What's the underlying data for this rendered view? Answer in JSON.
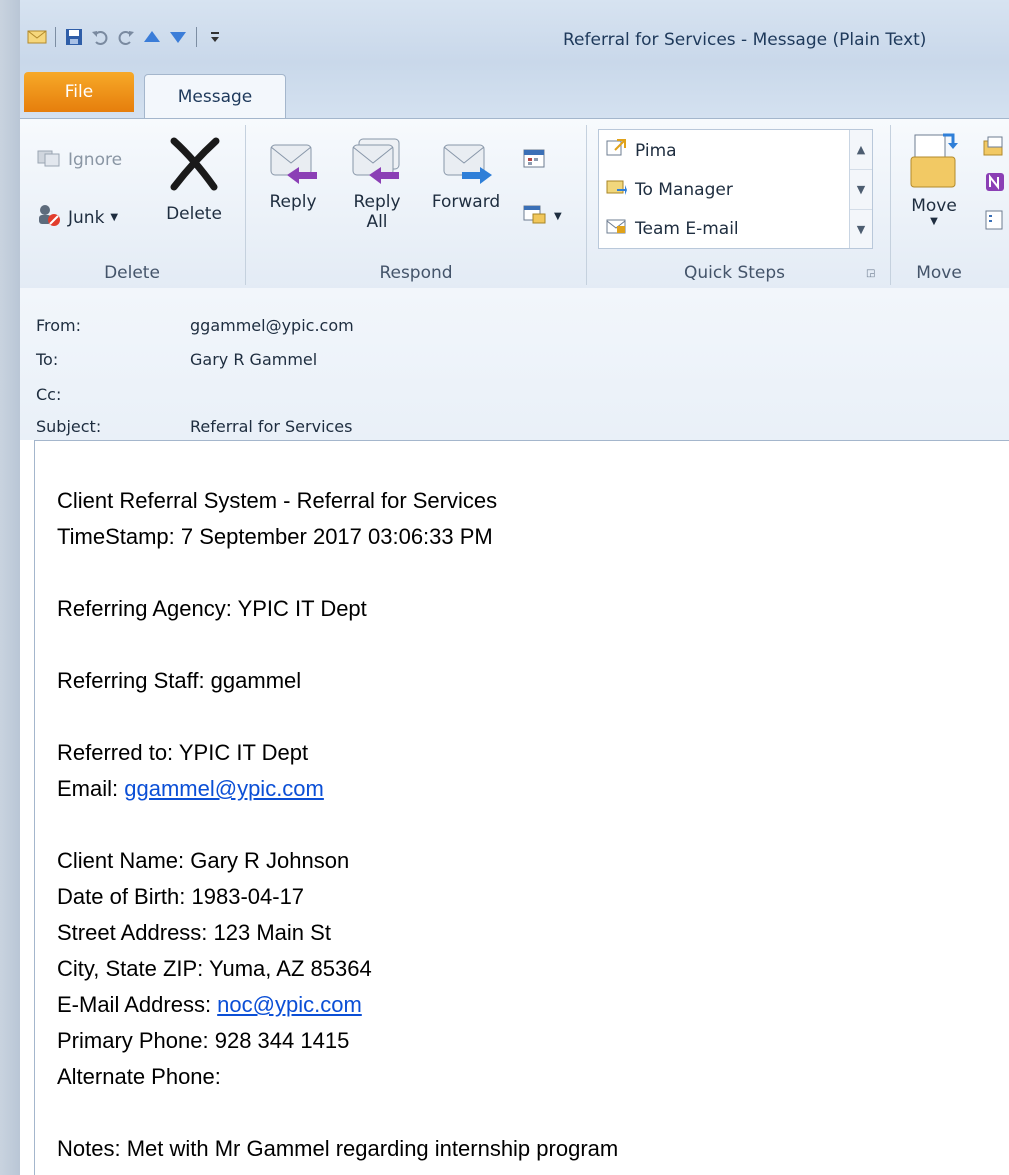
{
  "window": {
    "title": "Referral for Services  -  Message (Plain Text)"
  },
  "quick_access": [
    "mail-icon",
    "save-icon",
    "undo-icon",
    "redo-icon",
    "up-arrow-icon",
    "down-arrow-icon",
    "customize-icon"
  ],
  "tabs": {
    "file": "File",
    "message": "Message"
  },
  "ribbon": {
    "delete_group": {
      "ignore": "Ignore",
      "junk": "Junk",
      "delete": "Delete",
      "label": "Delete"
    },
    "respond_group": {
      "reply": "Reply",
      "reply_all_1": "Reply",
      "reply_all_2": "All",
      "forward": "Forward",
      "label": "Respond"
    },
    "quick_steps": {
      "items": [
        "Pima",
        "To Manager",
        "Team E-mail"
      ],
      "label": "Quick Steps"
    },
    "move_group": {
      "move": "Move",
      "label": "Move"
    }
  },
  "header": {
    "from_label": "From:",
    "from_value": "ggammel@ypic.com",
    "to_label": "To:",
    "to_value": "Gary R Gammel",
    "cc_label": "Cc:",
    "cc_value": "",
    "subject_label": "Subject:",
    "subject_value": "Referral for Services"
  },
  "body": {
    "line1": "Client Referral System - Referral for Services",
    "line2": "TimeStamp: 7 September 2017 03:06:33 PM",
    "agency": "Referring Agency: YPIC IT Dept",
    "staff": "Referring Staff: ggammel",
    "referred_to": "Referred to: YPIC IT Dept",
    "email_label": "Email: ",
    "email_link": "ggammel@ypic.com",
    "client_name": "Client Name: Gary R  Johnson",
    "dob": "Date of Birth: 1983-04-17",
    "street": "Street Address: 123 Main St",
    "city": "City, State ZIP: Yuma, AZ 85364",
    "client_email_label": "E-Mail Address: ",
    "client_email_link": "noc@ypic.com",
    "primary_phone": "Primary Phone: 928 344 1415",
    "alternate_phone": "Alternate Phone:",
    "notes": "Notes: Met with Mr Gammel regarding internship program"
  },
  "colors": {
    "file_tab": "#e67e0c",
    "link": "#0b4fd6",
    "title_text": "#1e395b"
  }
}
